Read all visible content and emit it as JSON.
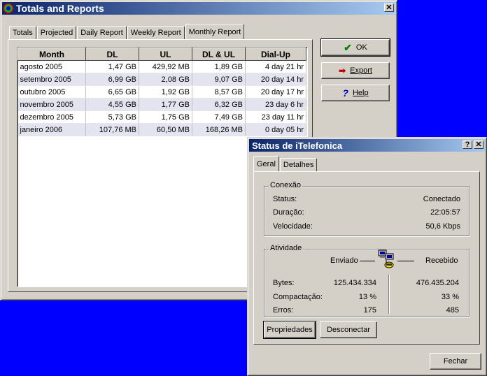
{
  "totals_window": {
    "title": "Totals and Reports",
    "close_glyph": "✕",
    "tabs": [
      {
        "label": "Totals"
      },
      {
        "label": "Projected"
      },
      {
        "label": "Daily Report"
      },
      {
        "label": "Weekly Report"
      },
      {
        "label": "Monthly Report"
      }
    ],
    "active_tab": "Monthly Report",
    "table": {
      "headers": [
        "Month",
        "DL",
        "UL",
        "DL & UL",
        "Dial-Up"
      ],
      "rows": [
        [
          "agosto 2005",
          "1,47 GB",
          "429,92 MB",
          "1,89 GB",
          "4 day 21 hr"
        ],
        [
          "setembro 2005",
          "6,99 GB",
          "2,08 GB",
          "9,07 GB",
          "20 day 14 hr"
        ],
        [
          "outubro 2005",
          "6,65 GB",
          "1,92 GB",
          "8,57 GB",
          "20 day 17 hr"
        ],
        [
          "novembro 2005",
          "4,55 GB",
          "1,77 GB",
          "6,32 GB",
          "23 day 6 hr"
        ],
        [
          "dezembro 2005",
          "5,73 GB",
          "1,75 GB",
          "7,49 GB",
          "23 day 11 hr"
        ],
        [
          "janeiro 2006",
          "107,76 MB",
          "60,50 MB",
          "168,26 MB",
          "0 day 05 hr"
        ]
      ]
    },
    "buttons": {
      "ok": "OK",
      "export": "Export",
      "help": "Help"
    }
  },
  "status_window": {
    "title": "Status de iTelefonica",
    "help_glyph": "?",
    "close_glyph": "✕",
    "tabs": [
      {
        "label": "Geral"
      },
      {
        "label": "Detalhes"
      }
    ],
    "active_tab": "Geral",
    "conexao": {
      "legend": "Conexão",
      "status_label": "Status:",
      "status_value": "Conectado",
      "duracao_label": "Duração:",
      "duracao_value": "22:05:57",
      "velocidade_label": "Velocidade:",
      "velocidade_value": "50,6 Kbps"
    },
    "atividade": {
      "legend": "Atividade",
      "enviado_label": "Enviado",
      "recebido_label": "Recebido",
      "bytes_label": "Bytes:",
      "bytes_sent": "125.434.334",
      "bytes_received": "476.435.204",
      "compactacao_label": "Compactação:",
      "compactacao_sent": "13 %",
      "compactacao_received": "33 %",
      "erros_label": "Erros:",
      "erros_sent": "175",
      "erros_received": "485"
    },
    "buttons": {
      "propriedades": "Propriedades",
      "desconectar": "Desconectar",
      "fechar": "Fechar"
    }
  },
  "colors": {
    "desktop": "#0000ff",
    "titlebar_start": "#0a246a",
    "titlebar_end": "#a6caf0",
    "face": "#d4d0c8"
  }
}
